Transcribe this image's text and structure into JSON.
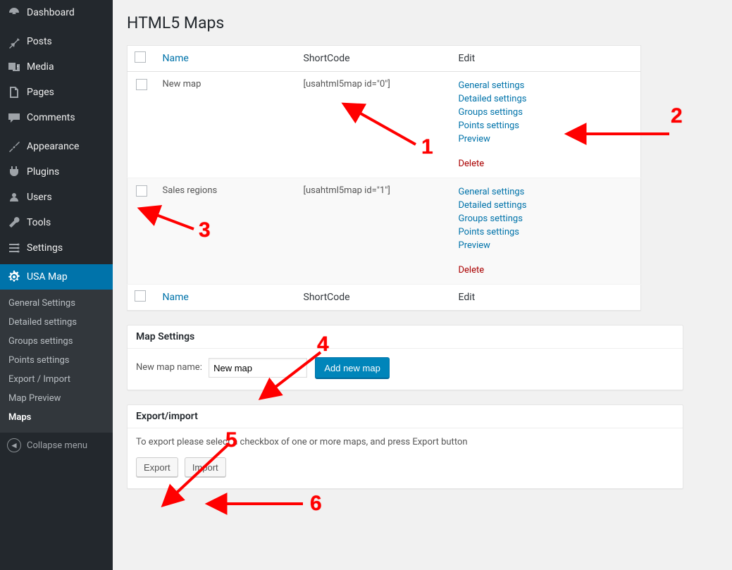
{
  "sidebar": {
    "items": [
      {
        "label": "Dashboard",
        "icon": "dashboard-icon"
      },
      {
        "label": "Posts",
        "icon": "pin-icon"
      },
      {
        "label": "Media",
        "icon": "media-icon"
      },
      {
        "label": "Pages",
        "icon": "pages-icon"
      },
      {
        "label": "Comments",
        "icon": "comments-icon"
      },
      {
        "label": "Appearance",
        "icon": "appearance-icon"
      },
      {
        "label": "Plugins",
        "icon": "plugins-icon"
      },
      {
        "label": "Users",
        "icon": "users-icon"
      },
      {
        "label": "Tools",
        "icon": "tools-icon"
      },
      {
        "label": "Settings",
        "icon": "settings-icon"
      },
      {
        "label": "USA Map",
        "icon": "gear-icon",
        "current": true
      }
    ],
    "submenu": [
      "General Settings",
      "Detailed settings",
      "Groups settings",
      "Points settings",
      "Export / Import",
      "Map Preview",
      "Maps"
    ],
    "submenu_current": "Maps",
    "collapse_label": "Collapse menu"
  },
  "page": {
    "title": "HTML5 Maps"
  },
  "table": {
    "headers": {
      "name": "Name",
      "shortcode": "ShortCode",
      "edit": "Edit"
    },
    "rows": [
      {
        "name": "New map",
        "shortcode": "[usahtml5map id=\"0\"]",
        "links": {
          "general": "General settings",
          "detailed": "Detailed settings",
          "groups": "Groups settings",
          "points": "Points settings",
          "preview": "Preview",
          "delete": "Delete"
        }
      },
      {
        "name": "Sales regions",
        "shortcode": "[usahtml5map id=\"1\"]",
        "links": {
          "general": "General settings",
          "detailed": "Detailed settings",
          "groups": "Groups settings",
          "points": "Points settings",
          "preview": "Preview",
          "delete": "Delete"
        }
      }
    ]
  },
  "map_settings": {
    "heading": "Map Settings",
    "label": "New map name:",
    "value": "New map",
    "add_button": "Add new map"
  },
  "export_import": {
    "heading": "Export/import",
    "help": "To export please select a checkbox of one or more maps, and press Export button",
    "export_button": "Export",
    "import_button": "Import"
  },
  "annotations": {
    "n1": "1",
    "n2": "2",
    "n3": "3",
    "n4": "4",
    "n5": "5",
    "n6": "6"
  }
}
